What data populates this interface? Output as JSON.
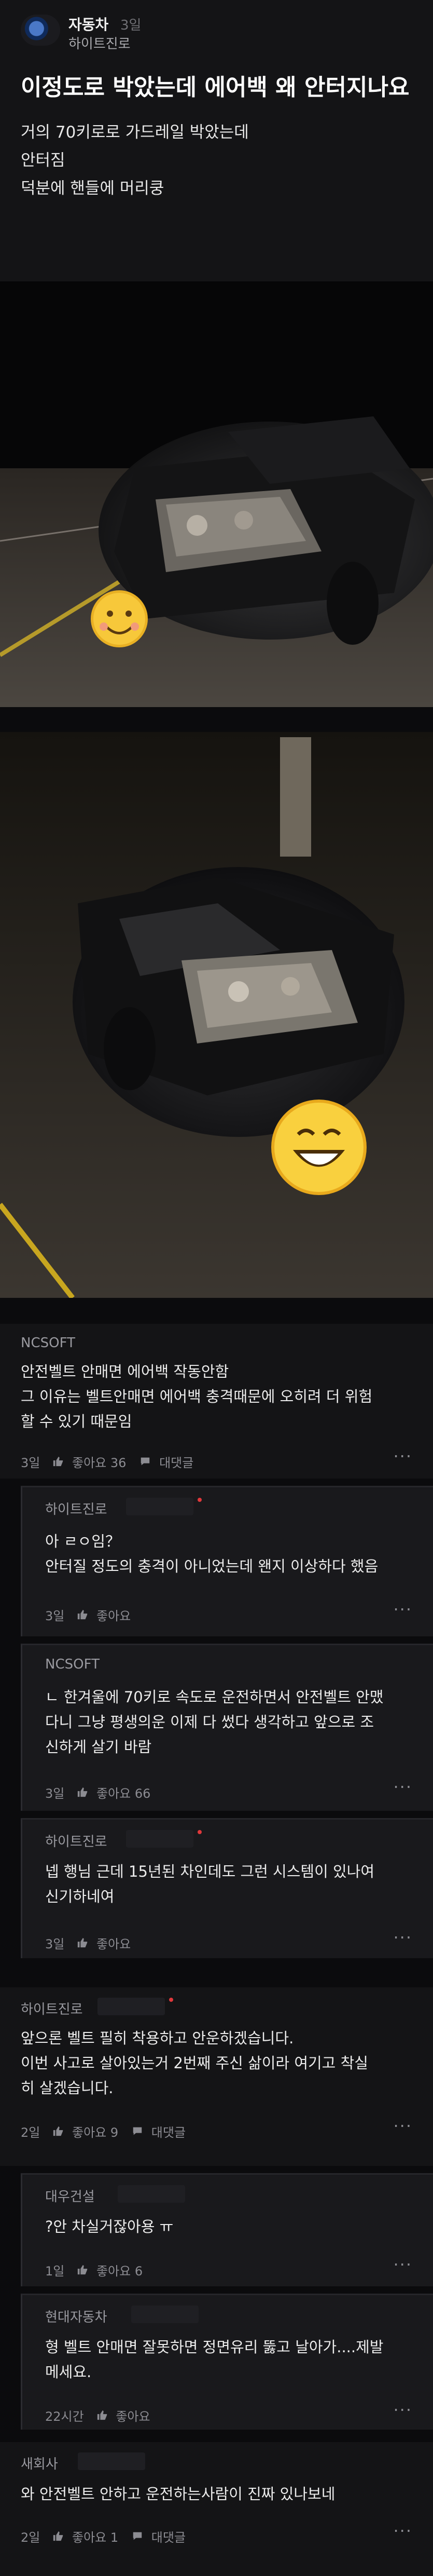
{
  "post": {
    "board": "자동차",
    "time": "3일",
    "company": "하이트진로",
    "title": "이정도로 박았는데 에어백 왜 안터지나요",
    "lines": [
      "거의 70키로로 가드레일 박았는데",
      "안터짐",
      "덕분에 핸들에 머리쿵"
    ]
  },
  "comments": [
    {
      "company": "NCSOFT",
      "lines": [
        "안전벨트 안매면 에어백 작동안함",
        "그 이유는 벨트안매면 에어백 충격때문에 오히려 더 위험",
        "할 수 있기 때문임"
      ],
      "time": "3일",
      "likes": "좋아요 36",
      "reply": "대댓글",
      "more": "···"
    },
    {
      "company": "하이트진로",
      "lines": [
        "아 ㄹㅇ임？",
        "안터질 정도의 충격이 아니었는데 왠지 이상하다 했음"
      ],
      "time": "3일",
      "likes": "좋아요",
      "more": "···"
    },
    {
      "company": "NCSOFT",
      "lines": [
        "ㄴ 한겨울에 70키로 속도로 운전하면서 안전벨트 안맸",
        "다니 그냥 평생의운 이제 다 썼다 생각하고 앞으로 조",
        "신하게 살기 바람"
      ],
      "time": "3일",
      "likes": "좋아요 66",
      "more": "···"
    },
    {
      "company": "하이트진로",
      "lines": [
        "넵 행님 근데 15년된 차인데도 그런 시스템이 있나여",
        "신기하네여"
      ],
      "time": "3일",
      "likes": "좋아요",
      "more": "···"
    },
    {
      "company": "하이트진로",
      "lines": [
        "앞으론 벨트 필히 착용하고 안운하겠습니다.",
        "이번 사고로 살아있는거 2번째 주신 삶이라 여기고 착실",
        "히 살겠습니다."
      ],
      "time": "2일",
      "likes": "좋아요 9",
      "reply": "대댓글",
      "more": "···"
    },
    {
      "company": "대우건설",
      "lines": [
        "?안 차실거잖아용 ㅠ"
      ],
      "time": "1일",
      "likes": "좋아요 6",
      "more": "···"
    },
    {
      "company": "현대자동차",
      "lines": [
        "형 벨트 안매면 잘못하면 정면유리 뚫고 날아가....제발",
        "메세요."
      ],
      "time": "22시간",
      "likes": "좋아요",
      "more": "···"
    },
    {
      "company": "새회사",
      "lines": [
        "와 안전벨트 안하고 운전하는사람이 진짜 있나보네"
      ],
      "time": "2일",
      "likes": "좋아요 1",
      "reply": "대댓글",
      "more": "···"
    }
  ],
  "icons": {
    "like": "thumbs-up-icon",
    "reply": "speech-bubble-icon",
    "more": "more-dots-icon"
  },
  "colors": {
    "background": "#0b0b0d",
    "card": "#141416",
    "reply_card": "#19191c",
    "author_dot": "#e0383b"
  }
}
